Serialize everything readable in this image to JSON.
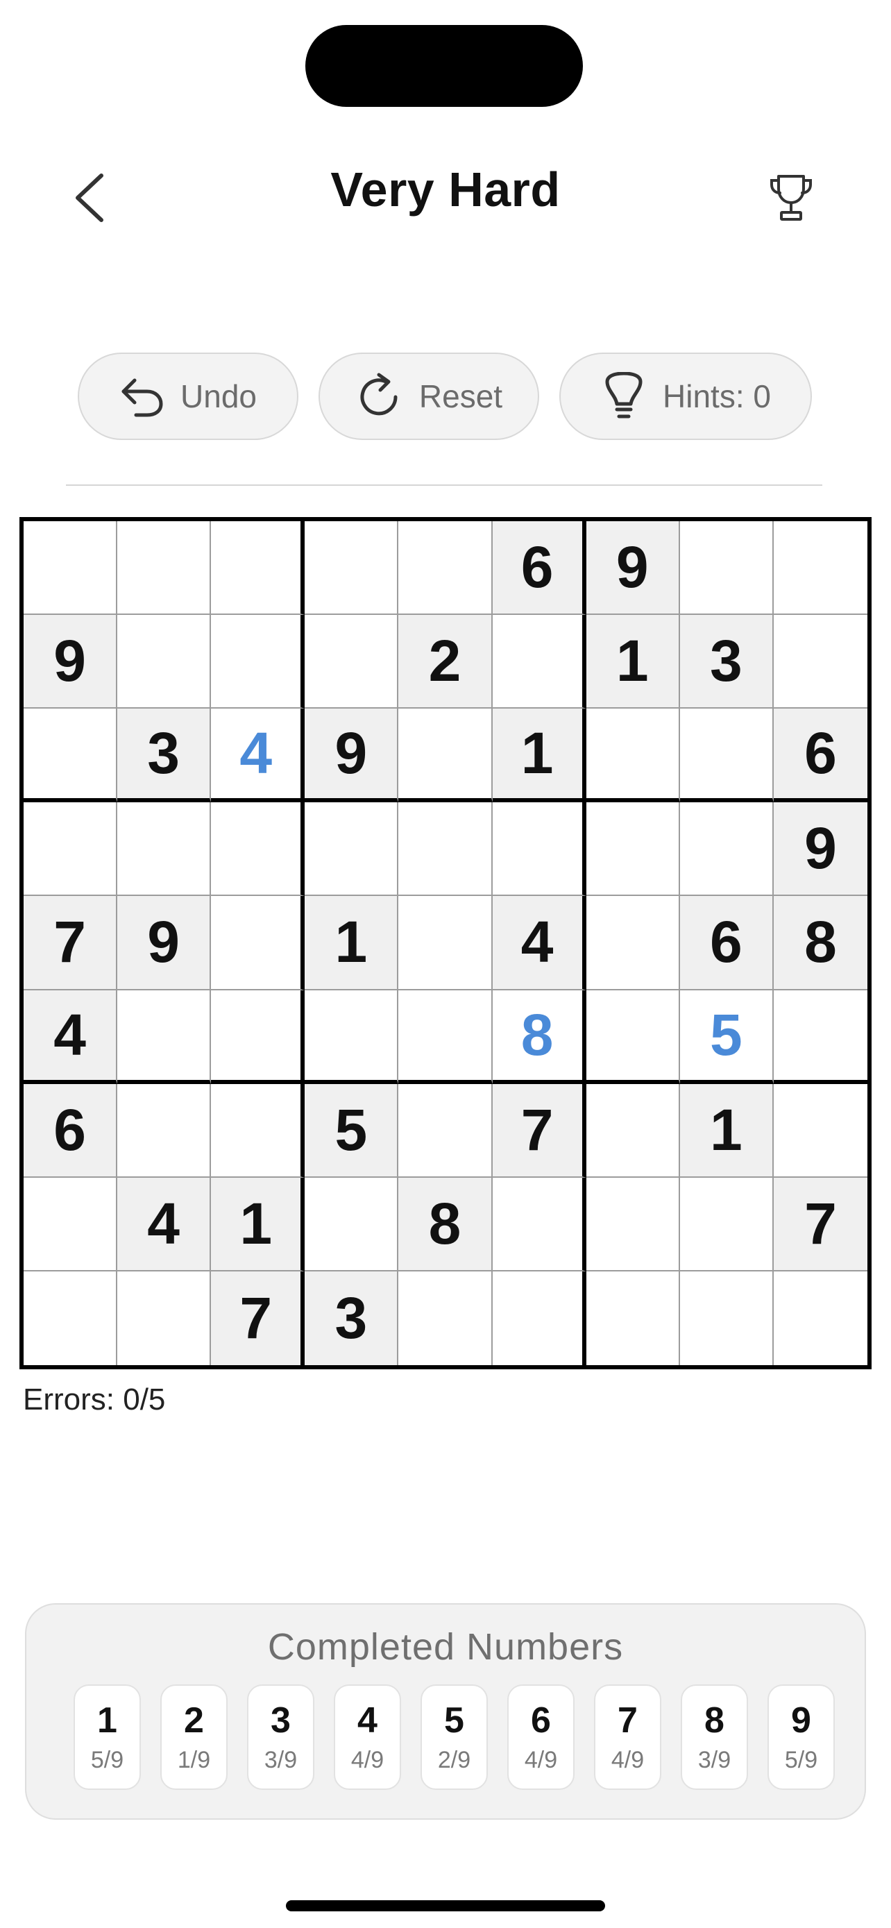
{
  "header": {
    "title": "Very Hard",
    "back_icon": "chevron-left-icon",
    "trophy_icon": "trophy-icon"
  },
  "toolbar": {
    "undo_label": "Undo",
    "reset_label": "Reset",
    "hints_label": "Hints: 0"
  },
  "board": {
    "rows": [
      [
        {
          "v": "",
          "k": "empty"
        },
        {
          "v": "",
          "k": "empty"
        },
        {
          "v": "",
          "k": "empty"
        },
        {
          "v": "",
          "k": "empty"
        },
        {
          "v": "",
          "k": "empty"
        },
        {
          "v": "6",
          "k": "given"
        },
        {
          "v": "9",
          "k": "given"
        },
        {
          "v": "",
          "k": "empty"
        },
        {
          "v": "",
          "k": "empty"
        }
      ],
      [
        {
          "v": "9",
          "k": "given"
        },
        {
          "v": "",
          "k": "empty"
        },
        {
          "v": "",
          "k": "empty"
        },
        {
          "v": "",
          "k": "empty"
        },
        {
          "v": "2",
          "k": "given"
        },
        {
          "v": "",
          "k": "empty"
        },
        {
          "v": "1",
          "k": "given"
        },
        {
          "v": "3",
          "k": "given"
        },
        {
          "v": "",
          "k": "empty"
        }
      ],
      [
        {
          "v": "",
          "k": "empty"
        },
        {
          "v": "3",
          "k": "given"
        },
        {
          "v": "4",
          "k": "user"
        },
        {
          "v": "9",
          "k": "given"
        },
        {
          "v": "",
          "k": "empty"
        },
        {
          "v": "1",
          "k": "given"
        },
        {
          "v": "",
          "k": "empty"
        },
        {
          "v": "",
          "k": "empty"
        },
        {
          "v": "6",
          "k": "given"
        }
      ],
      [
        {
          "v": "",
          "k": "empty"
        },
        {
          "v": "",
          "k": "empty"
        },
        {
          "v": "",
          "k": "empty"
        },
        {
          "v": "",
          "k": "empty"
        },
        {
          "v": "",
          "k": "empty"
        },
        {
          "v": "",
          "k": "empty"
        },
        {
          "v": "",
          "k": "empty"
        },
        {
          "v": "",
          "k": "empty"
        },
        {
          "v": "9",
          "k": "given"
        }
      ],
      [
        {
          "v": "7",
          "k": "given"
        },
        {
          "v": "9",
          "k": "given"
        },
        {
          "v": "",
          "k": "empty"
        },
        {
          "v": "1",
          "k": "given"
        },
        {
          "v": "",
          "k": "empty"
        },
        {
          "v": "4",
          "k": "given"
        },
        {
          "v": "",
          "k": "empty"
        },
        {
          "v": "6",
          "k": "given"
        },
        {
          "v": "8",
          "k": "given"
        }
      ],
      [
        {
          "v": "4",
          "k": "given"
        },
        {
          "v": "",
          "k": "empty"
        },
        {
          "v": "",
          "k": "empty"
        },
        {
          "v": "",
          "k": "empty"
        },
        {
          "v": "",
          "k": "empty"
        },
        {
          "v": "8",
          "k": "user"
        },
        {
          "v": "",
          "k": "empty"
        },
        {
          "v": "5",
          "k": "user"
        },
        {
          "v": "",
          "k": "empty"
        }
      ],
      [
        {
          "v": "6",
          "k": "given"
        },
        {
          "v": "",
          "k": "empty"
        },
        {
          "v": "",
          "k": "empty"
        },
        {
          "v": "5",
          "k": "given"
        },
        {
          "v": "",
          "k": "empty"
        },
        {
          "v": "7",
          "k": "given"
        },
        {
          "v": "",
          "k": "empty"
        },
        {
          "v": "1",
          "k": "given"
        },
        {
          "v": "",
          "k": "empty"
        }
      ],
      [
        {
          "v": "",
          "k": "empty"
        },
        {
          "v": "4",
          "k": "given"
        },
        {
          "v": "1",
          "k": "given"
        },
        {
          "v": "",
          "k": "empty"
        },
        {
          "v": "8",
          "k": "given"
        },
        {
          "v": "",
          "k": "empty"
        },
        {
          "v": "",
          "k": "empty"
        },
        {
          "v": "",
          "k": "empty"
        },
        {
          "v": "7",
          "k": "given"
        }
      ],
      [
        {
          "v": "",
          "k": "empty"
        },
        {
          "v": "",
          "k": "empty"
        },
        {
          "v": "7",
          "k": "given"
        },
        {
          "v": "3",
          "k": "given"
        },
        {
          "v": "",
          "k": "empty"
        },
        {
          "v": "",
          "k": "empty"
        },
        {
          "v": "",
          "k": "empty"
        },
        {
          "v": "",
          "k": "empty"
        },
        {
          "v": "",
          "k": "empty"
        }
      ]
    ],
    "colors": {
      "given_bg": "#f0f0f0",
      "user_digit": "#4a8ad8"
    }
  },
  "status": {
    "errors": "Errors: 0/5"
  },
  "completed": {
    "title": "Completed Numbers",
    "numbers": [
      {
        "num": "1",
        "count": "5/9"
      },
      {
        "num": "2",
        "count": "1/9"
      },
      {
        "num": "3",
        "count": "3/9"
      },
      {
        "num": "4",
        "count": "4/9"
      },
      {
        "num": "5",
        "count": "2/9"
      },
      {
        "num": "6",
        "count": "4/9"
      },
      {
        "num": "7",
        "count": "4/9"
      },
      {
        "num": "8",
        "count": "3/9"
      },
      {
        "num": "9",
        "count": "5/9"
      }
    ]
  }
}
